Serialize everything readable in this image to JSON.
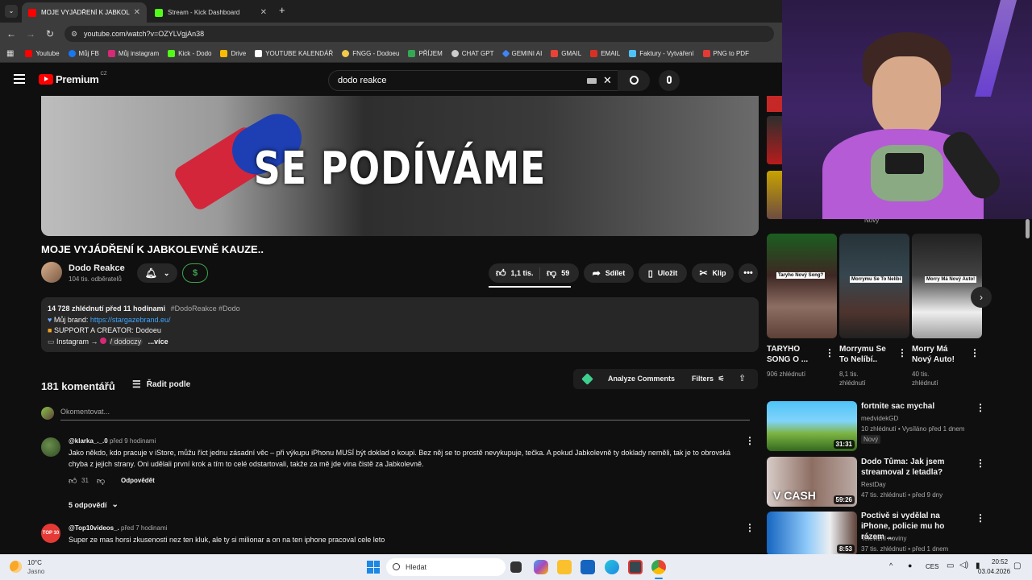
{
  "browser": {
    "tabs": [
      {
        "label": "MOJE VYJÁDŘENÍ K JABKOLEVN",
        "active": true
      },
      {
        "label": "Stream - Kick Dashboard",
        "active": false
      }
    ],
    "new_tab": "+",
    "url": "youtube.com/watch?v=OZYLVgjAn38",
    "bookmarks": [
      {
        "label": "Youtube",
        "color": "#ff0000"
      },
      {
        "label": "Můj FB",
        "color": "#1877f2"
      },
      {
        "label": "Můj instagram",
        "color": "#d62976"
      },
      {
        "label": "Kick - Dodo",
        "color": "#53fc18"
      },
      {
        "label": "Drive",
        "color": "#fbbc04"
      },
      {
        "label": "YOUTUBE KALENDÁŘ",
        "color": "#ffffff"
      },
      {
        "label": "FNGG - Dodoeu",
        "color": "#f2c94c"
      },
      {
        "label": "PŘÍJEM",
        "color": "#34a853"
      },
      {
        "label": "CHAT GPT",
        "color": "#cccccc"
      },
      {
        "label": "GEMINI AI",
        "color": "#4285f4"
      },
      {
        "label": "GMAIL",
        "color": "#ea4335"
      },
      {
        "label": "EMAIL",
        "color": "#d93025"
      },
      {
        "label": "Faktury - Vytváření",
        "color": "#4fc3f7"
      },
      {
        "label": "PNG to PDF",
        "color": "#e53935"
      }
    ]
  },
  "youtube": {
    "logo": "Premium",
    "logo_region": "CZ",
    "search_value": "dodo reakce"
  },
  "video": {
    "overlay_text": "SE PODÍVÁME",
    "title": "MOJE VYJÁDŘENÍ K JABKOLEVNĚ KAUZE..",
    "channel_name": "Dodo Reakce",
    "subscribers": "104 tis. odběratelů",
    "likes": "1,1 tis.",
    "dislikes": "59",
    "share_label": "Sdílet",
    "save_label": "Uložit",
    "clip_label": "Klip"
  },
  "description": {
    "stats": "14 728 zhlédnutí  před 11 hodinami",
    "tags": "#DodoReakce #Dodo",
    "line1_label": "Můj brand:",
    "line1_link": "https://stargazebrand.eu/",
    "line2": "SUPPORT A CREATOR: Dodoeu",
    "line3_prefix": "Instagram →",
    "line3_handle": "/ dodoczy",
    "more": "...více"
  },
  "comments_header": {
    "count": "181 komentářů",
    "sort_label": "Řadit podle",
    "analyze_label": "Analyze Comments",
    "filters_label": "Filters",
    "placeholder": "Okomentovat..."
  },
  "comments": [
    {
      "author": "@klarka_._.0",
      "time": "před 9 hodinami",
      "text": "Jako někdo, kdo pracuje v iStore, můžu říct jednu zásadní věc – při výkupu iPhonu MUSÍ být doklad o koupi. Bez něj se to prostě nevykupuje, tečka. A pokud Jabkolevně ty doklady neměli, tak je to obrovská chyba z jejich strany. Oni udělali první krok a tím to celé odstartovali, takže za mě jde vina čistě za Jabkolevně.",
      "likes": "31",
      "reply_label": "Odpovědět",
      "replies": "5 odpovědí"
    },
    {
      "author": "@Top10videos_.",
      "time": "před 7 hodinami",
      "text": "Super ze mas horsi zkusenosti nez ten kluk, ale ty si milionar a on na ten iphone pracoval cele leto"
    }
  ],
  "shorts": [
    {
      "title": "TARYHO SONG O ...",
      "meta": "906 zhlédnutí",
      "caption": "Taryho Nový Song?"
    },
    {
      "title": "Morrymu Se To Nelíbí..",
      "meta": "8,1 tis. zhlédnutí",
      "caption": "Morrymu Se To Nelíbí"
    },
    {
      "title": "Morry Má Nový Auto!",
      "meta": "40 tis. zhlédnutí",
      "caption": "Morry Má Nový Auto!"
    }
  ],
  "sidebar_top_badge": "Nový",
  "related": [
    {
      "title": "fortnite sac mychal",
      "channel": "medvidekGD",
      "meta": "10 zhlédnutí • Vysíláno před 1 dnem",
      "badge": "Nový",
      "duration": "31:31"
    },
    {
      "title": "Dodo Tůma: Jak jsem streamoval z letadla?",
      "channel": "RestDay",
      "meta": "47 tis. zhlédnutí • před 9 dny",
      "duration": "59:26",
      "thumb_text": "V CASH"
    },
    {
      "title": "Poctivě si vydělal na iPhone, policie mu ho rázem ...",
      "channel": "Televizní noviny",
      "meta": "37 tis. zhlédnutí • před 1 dnem",
      "duration": "8:53"
    }
  ],
  "taskbar": {
    "temp": "10°C",
    "weather": "Jasno",
    "search_placeholder": "Hledat",
    "lang": "CES",
    "time": "20:52",
    "date": "03.04.2026"
  }
}
